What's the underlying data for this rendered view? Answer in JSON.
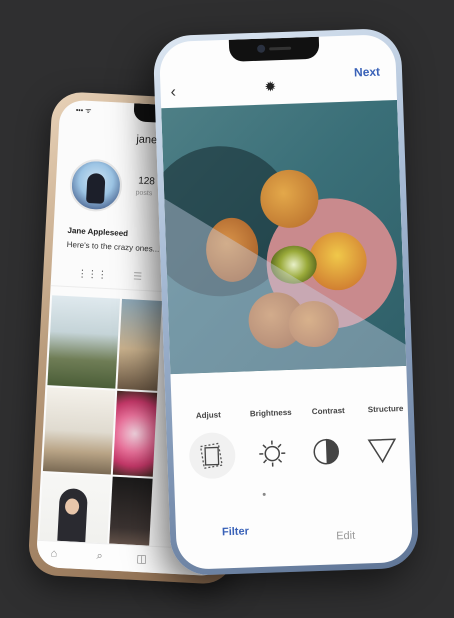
{
  "profile_phone": {
    "username": "janeapple",
    "posts_count": "128",
    "posts_label": "posts",
    "name": "Jane Appleseed",
    "bio": "Here's to the crazy ones..."
  },
  "editor_phone": {
    "next_label": "Next",
    "tools": [
      {
        "label": "Adjust",
        "icon": "adjust-icon"
      },
      {
        "label": "Brightness",
        "icon": "brightness-icon"
      },
      {
        "label": "Contrast",
        "icon": "contrast-icon"
      },
      {
        "label": "Structure",
        "icon": "structure-icon"
      }
    ],
    "filter_label": "Filter",
    "edit_label": "Edit"
  }
}
